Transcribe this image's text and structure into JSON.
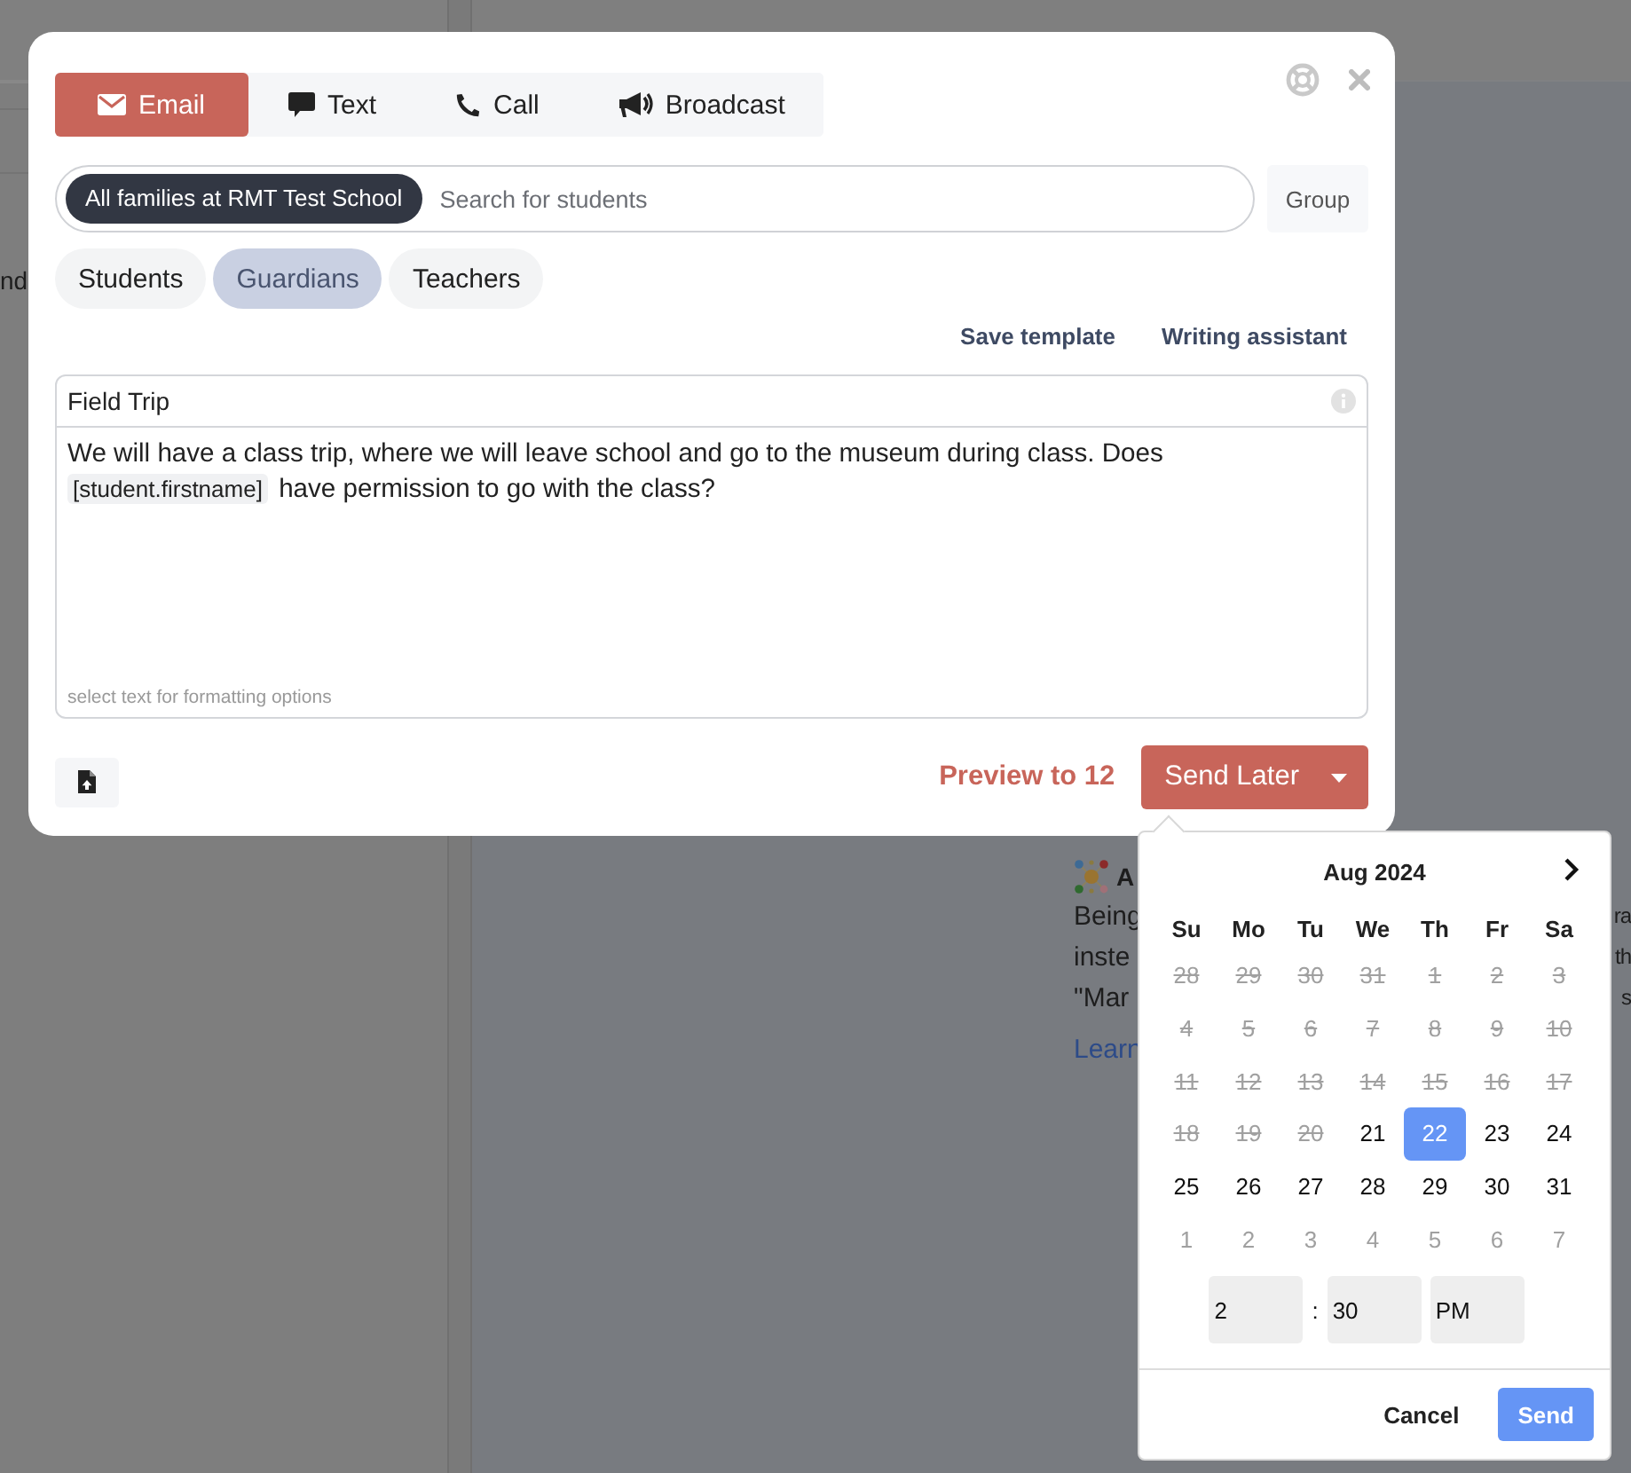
{
  "background": {
    "sidebar_fragment": "nd",
    "article": {
      "heading": "A",
      "lines": [
        {
          "left": "Being",
          "right": "ra"
        },
        {
          "left": "inste",
          "right": "th"
        },
        {
          "left": "\"Mar",
          "right": "s"
        }
      ],
      "link": "Learn"
    }
  },
  "modal": {
    "tabs": [
      {
        "kind": "email",
        "label": "Email",
        "selected": true
      },
      {
        "kind": "text",
        "label": "Text",
        "selected": false
      },
      {
        "kind": "call",
        "label": "Call",
        "selected": false
      },
      {
        "kind": "broadcast",
        "label": "Broadcast",
        "selected": false
      }
    ],
    "recipients": {
      "chips": [
        "All families at RMT Test School"
      ],
      "placeholder": "Search for students",
      "group_button": "Group"
    },
    "audience": [
      {
        "label": "Students",
        "selected": false
      },
      {
        "label": "Guardians",
        "selected": true
      },
      {
        "label": "Teachers",
        "selected": false
      }
    ],
    "links": [
      "Save template",
      "Writing assistant"
    ],
    "editor": {
      "subject": "Field Trip",
      "body": [
        {
          "kind": "text",
          "text": "We will have a class trip, where we will leave school and go to the museum during class. Does"
        },
        {
          "kind": "token",
          "text": "[student.firstname]"
        },
        {
          "kind": "text",
          "text": "have permission to go with the class?"
        }
      ],
      "hint": "select text for formatting options"
    },
    "preview": "Preview to 12",
    "send_button": "Send Later"
  },
  "scheduler": {
    "month": "Aug 2024",
    "weekdays": [
      "Su",
      "Mo",
      "Tu",
      "We",
      "Th",
      "Fr",
      "Sa"
    ],
    "weeks": [
      [
        {
          "day": "28",
          "kind": "disabled",
          "selected": false
        },
        {
          "day": "29",
          "kind": "disabled",
          "selected": false
        },
        {
          "day": "30",
          "kind": "disabled",
          "selected": false
        },
        {
          "day": "31",
          "kind": "disabled",
          "selected": false
        },
        {
          "day": "1",
          "kind": "disabled",
          "selected": false
        },
        {
          "day": "2",
          "kind": "disabled",
          "selected": false
        },
        {
          "day": "3",
          "kind": "disabled",
          "selected": false
        }
      ],
      [
        {
          "day": "4",
          "kind": "disabled",
          "selected": false
        },
        {
          "day": "5",
          "kind": "disabled",
          "selected": false
        },
        {
          "day": "6",
          "kind": "disabled",
          "selected": false
        },
        {
          "day": "7",
          "kind": "disabled",
          "selected": false
        },
        {
          "day": "8",
          "kind": "disabled",
          "selected": false
        },
        {
          "day": "9",
          "kind": "disabled",
          "selected": false
        },
        {
          "day": "10",
          "kind": "disabled",
          "selected": false
        }
      ],
      [
        {
          "day": "11",
          "kind": "disabled",
          "selected": false
        },
        {
          "day": "12",
          "kind": "disabled",
          "selected": false
        },
        {
          "day": "13",
          "kind": "disabled",
          "selected": false
        },
        {
          "day": "14",
          "kind": "disabled",
          "selected": false
        },
        {
          "day": "15",
          "kind": "disabled",
          "selected": false
        },
        {
          "day": "16",
          "kind": "disabled",
          "selected": false
        },
        {
          "day": "17",
          "kind": "disabled",
          "selected": false
        }
      ],
      [
        {
          "day": "18",
          "kind": "disabled",
          "selected": false
        },
        {
          "day": "19",
          "kind": "disabled",
          "selected": false
        },
        {
          "day": "20",
          "kind": "disabled",
          "selected": false
        },
        {
          "day": "21",
          "kind": "available",
          "selected": false
        },
        {
          "day": "22",
          "kind": "available",
          "selected": true
        },
        {
          "day": "23",
          "kind": "available",
          "selected": false
        },
        {
          "day": "24",
          "kind": "available",
          "selected": false
        }
      ],
      [
        {
          "day": "25",
          "kind": "available",
          "selected": false
        },
        {
          "day": "26",
          "kind": "available",
          "selected": false
        },
        {
          "day": "27",
          "kind": "available",
          "selected": false
        },
        {
          "day": "28",
          "kind": "available",
          "selected": false
        },
        {
          "day": "29",
          "kind": "available",
          "selected": false
        },
        {
          "day": "30",
          "kind": "available",
          "selected": false
        },
        {
          "day": "31",
          "kind": "available",
          "selected": false
        }
      ],
      [
        {
          "day": "1",
          "kind": "other_month",
          "selected": false
        },
        {
          "day": "2",
          "kind": "other_month",
          "selected": false
        },
        {
          "day": "3",
          "kind": "other_month",
          "selected": false
        },
        {
          "day": "4",
          "kind": "other_month",
          "selected": false
        },
        {
          "day": "5",
          "kind": "other_month",
          "selected": false
        },
        {
          "day": "6",
          "kind": "other_month",
          "selected": false
        },
        {
          "day": "7",
          "kind": "other_month",
          "selected": false
        }
      ]
    ],
    "time": {
      "hour": "2",
      "separator": ":",
      "minute": "30",
      "period": "PM"
    },
    "cancel": "Cancel",
    "send": "Send"
  }
}
